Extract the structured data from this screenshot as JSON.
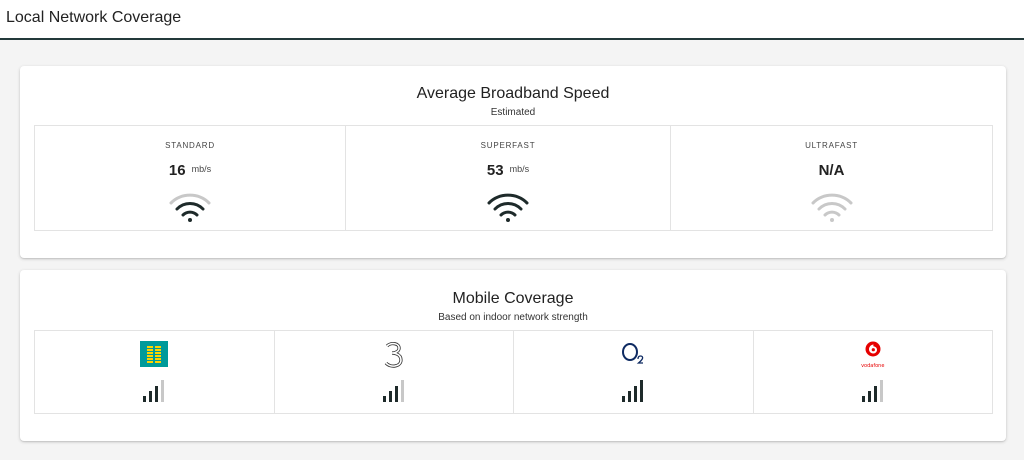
{
  "header": {
    "title": "Local Network Coverage"
  },
  "broadband": {
    "title": "Average Broadband Speed",
    "subtitle": "Estimated",
    "tiers": [
      {
        "label": "STANDARD",
        "value": "16",
        "unit": "mb/s",
        "wifi_icon": "wifi-icon",
        "wifi_color": "#1e2a2a",
        "wifi_level": "medium"
      },
      {
        "label": "SUPERFAST",
        "value": "53",
        "unit": "mb/s",
        "wifi_icon": "wifi-icon",
        "wifi_color": "#1e2a2a",
        "wifi_level": "full"
      },
      {
        "label": "ULTRAFAST",
        "value": "N/A",
        "unit": "",
        "wifi_icon": "wifi-icon",
        "wifi_color": "#c8c8c8",
        "wifi_level": "none"
      }
    ]
  },
  "mobile": {
    "title": "Mobile Coverage",
    "subtitle": "Based on indoor network strength",
    "operators": [
      {
        "name": "EE",
        "logo": "ee-logo",
        "bars": 3,
        "max_bars": 4
      },
      {
        "name": "Three",
        "logo": "three-logo",
        "bars": 3,
        "max_bars": 4
      },
      {
        "name": "O2",
        "logo": "o2-logo",
        "bars": 4,
        "max_bars": 4
      },
      {
        "name": "Vodafone",
        "logo": "vodafone-logo",
        "logo_text": "vodafone",
        "bars": 3,
        "max_bars": 4
      }
    ]
  },
  "colors": {
    "active": "#1e2a2a",
    "inactive": "#c8c8c8",
    "ee": "#009a9a",
    "ee_mark": "#ffd400",
    "o2": "#0e2a62",
    "vodafone": "#e60000"
  }
}
